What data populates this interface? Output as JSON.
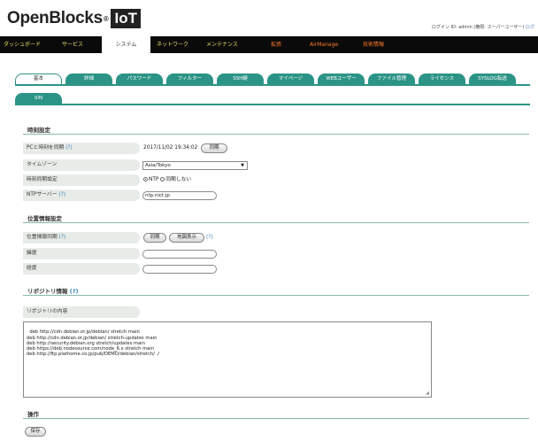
{
  "header": {
    "logo_text": "OpenBlocks",
    "logo_reg": "®",
    "logo_badge": "IoT",
    "user_info": "ログイン ID: admin (権限: スーパーユーザー)",
    "user_link": "ログ"
  },
  "nav": {
    "items": [
      {
        "label": "ダッシュボード"
      },
      {
        "label": "サービス"
      },
      {
        "label": "システム"
      },
      {
        "label": "ネットワーク"
      },
      {
        "label": "メンテナンス"
      },
      {
        "label": "拡張"
      },
      {
        "label": "AirManage"
      },
      {
        "label": "技術情報"
      }
    ]
  },
  "subtabs": [
    {
      "label": "基本"
    },
    {
      "label": "詳細"
    },
    {
      "label": "パスワード"
    },
    {
      "label": "フィルター"
    },
    {
      "label": "SSH鍵"
    },
    {
      "label": "マイページ"
    },
    {
      "label": "WEBユーザー"
    },
    {
      "label": "ファイル管理"
    },
    {
      "label": "ライセンス"
    },
    {
      "label": "SYSLOG転送"
    },
    {
      "label": "SIN"
    }
  ],
  "time_section": {
    "title": "時刻設定",
    "sync_pc_label": "PCと時刻を同期",
    "help": "(?)",
    "current_time": "2017/11/02 19:34:02",
    "sync_button": "同期",
    "timezone_label": "タイムゾーン",
    "timezone_value": "Asia/Tokyo",
    "sync_method_label": "時刻同期設定",
    "ntp_option": "NTP",
    "no_sync_option": "同期しない",
    "ntp_server_label": "NTPサーバー",
    "ntp_server_value": "ntp.nict.jp"
  },
  "location_section": {
    "title": "位置情報設定",
    "sync_label": "位置情報同期",
    "help": "(?)",
    "sync_button": "同期",
    "map_button": "地図表示",
    "latitude_label": "緯度",
    "longitude_label": "経度",
    "latitude_value": "",
    "longitude_value": ""
  },
  "repo_section": {
    "title": "リポジトリ情報",
    "help": "(?)",
    "content_label": "リポジトリの内容",
    "content": "deb http://cdn.debian.or.jp/debian/ stretch main\ndeb http://cdn.debian.or.jp/debian/ stretch-updates main\ndeb http://security.debian.org stretch/updates main\ndeb https://deb.nodesource.com/node_6.x stretch main\ndeb http://ftp.plathome.co.jp/pub/DEMO/debian/stretch/ ./"
  },
  "operation_section": {
    "title": "操作",
    "save_button": "保存"
  }
}
